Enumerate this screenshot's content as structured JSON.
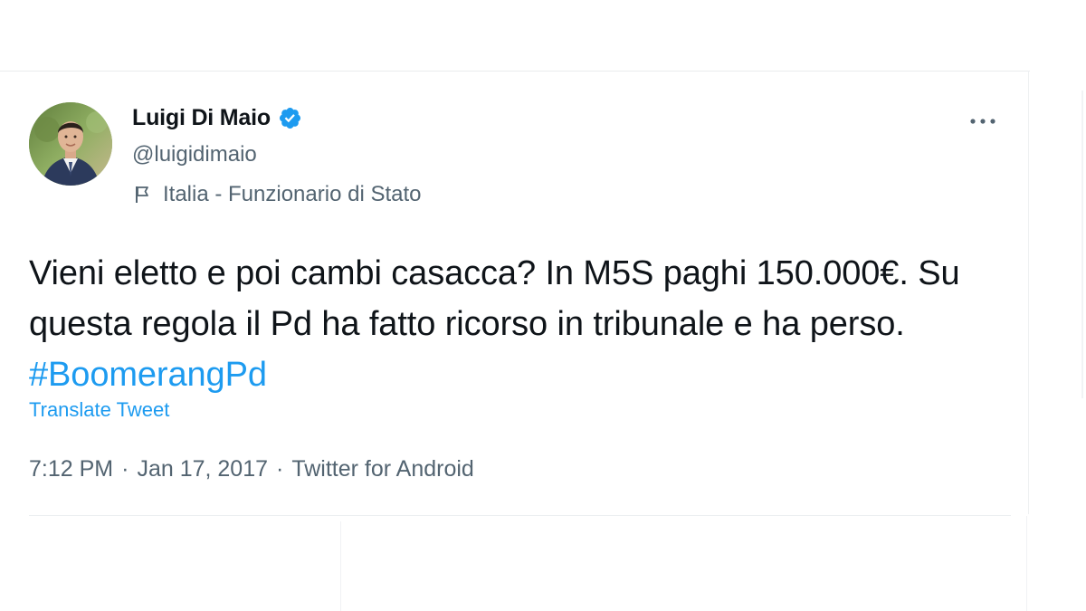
{
  "tweet": {
    "author": {
      "display_name": "Luigi Di Maio",
      "handle": "@luigidimaio",
      "verified_icon": "verified-badge-icon",
      "avatar": "avatar"
    },
    "label": {
      "icon": "flag-icon",
      "text": "Italia - Funzionario di Stato"
    },
    "text": "Vieni eletto e poi cambi casacca? In M5S paghi 150.000€. Su questa regola il Pd ha fatto ricorso in tribunale e ha perso.",
    "hashtag": "#BoomerangPd",
    "translate_label": "Translate Tweet",
    "meta": {
      "time": "7:12 PM",
      "date": "Jan 17, 2017",
      "source": "Twitter for Android",
      "separator": "·"
    },
    "more_icon": "more-options-icon"
  },
  "colors": {
    "text_primary": "#0f1419",
    "text_secondary": "#536471",
    "accent": "#1d9bf0"
  }
}
